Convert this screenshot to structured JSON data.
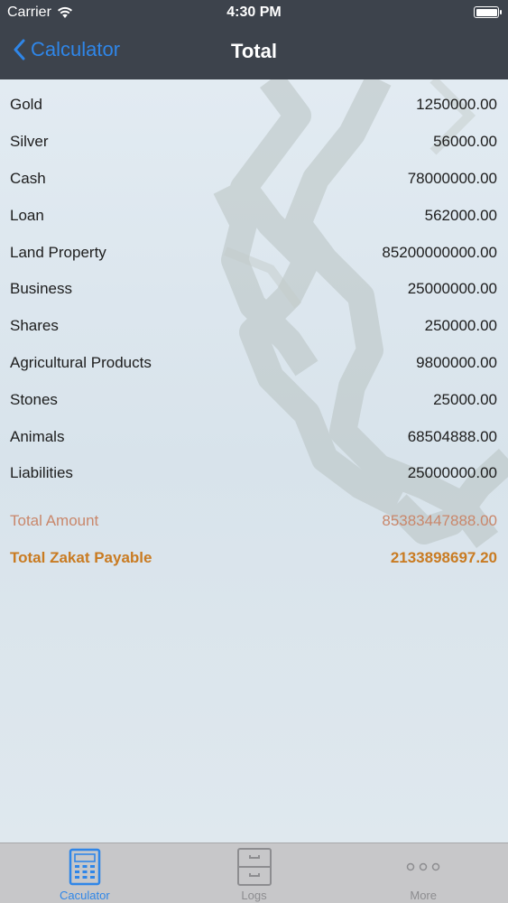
{
  "status_bar": {
    "carrier": "Carrier",
    "time": "4:30 PM"
  },
  "nav": {
    "back_label": "Calculator",
    "title": "Total"
  },
  "items": [
    {
      "label": "Gold",
      "value": "1250000.00"
    },
    {
      "label": "Silver",
      "value": "56000.00"
    },
    {
      "label": "Cash",
      "value": "78000000.00"
    },
    {
      "label": "Loan",
      "value": "562000.00"
    },
    {
      "label": "Land Property",
      "value": "85200000000.00"
    },
    {
      "label": "Business",
      "value": "25000000.00"
    },
    {
      "label": "Shares",
      "value": "250000.00"
    },
    {
      "label": "Agricultural Products",
      "value": "9800000.00"
    },
    {
      "label": "Stones",
      "value": "25000.00"
    },
    {
      "label": "Animals",
      "value": "68504888.00"
    },
    {
      "label": "Liabilities",
      "value": "25000000.00"
    }
  ],
  "totals": {
    "amount_label": "Total Amount",
    "amount_value": "85383447888.00",
    "zakat_label": "Total Zakat Payable",
    "zakat_value": "2133898697.20"
  },
  "tabs": [
    {
      "label": "Caculator",
      "icon": "calculator-icon",
      "active": true
    },
    {
      "label": "Logs",
      "icon": "filing-cabinet-icon",
      "active": false
    },
    {
      "label": "More",
      "icon": "more-dots-icon",
      "active": false
    }
  ],
  "colors": {
    "bar_background": "#3d434c",
    "accent": "#2f86e8",
    "total_amount": "#c9876b",
    "total_zakat": "#c97b22"
  }
}
